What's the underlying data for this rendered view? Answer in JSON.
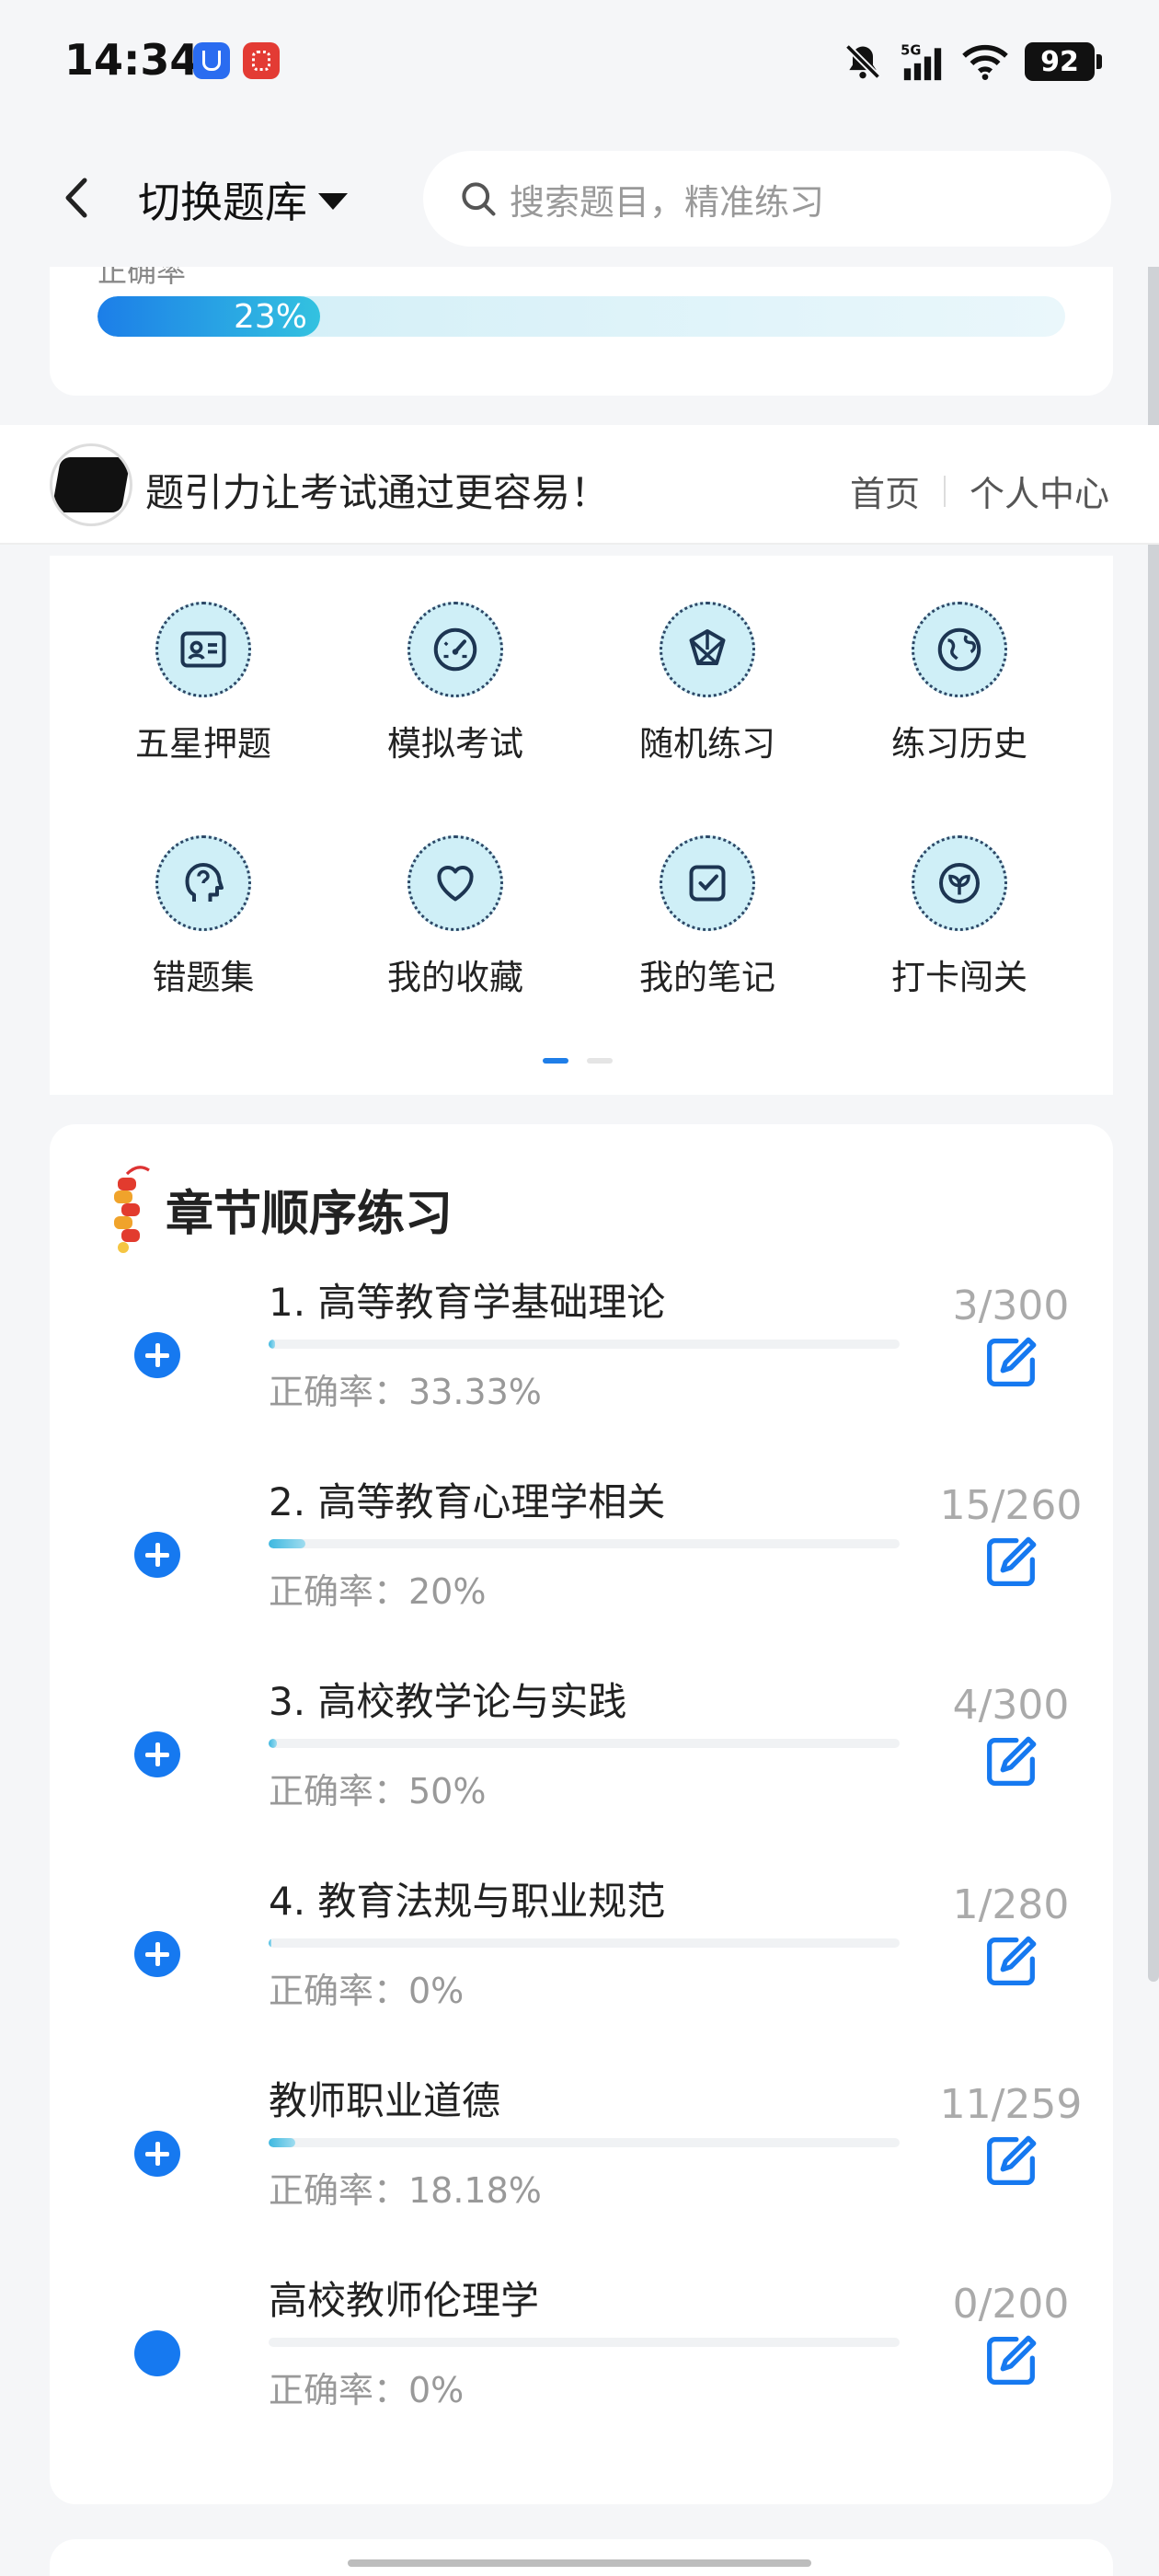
{
  "status_bar": {
    "time": "14:34",
    "battery": "92",
    "icons": [
      "app-u-icon",
      "app-red-icon",
      "bell-muted-icon",
      "signal-5g-icon",
      "wifi-icon",
      "battery-icon"
    ]
  },
  "header": {
    "switch_label": "切换题库",
    "search_placeholder": "搜索题目，精准练习"
  },
  "accuracy_card": {
    "label": "正确率",
    "percent_text": "23%",
    "percent_value": 23
  },
  "brand": {
    "slogan": "题引力让考试通过更容易！",
    "links": [
      "首页",
      "个人中心"
    ]
  },
  "menu": {
    "items": [
      {
        "label": "五星押题",
        "icon": "id-card-icon"
      },
      {
        "label": "模拟考试",
        "icon": "speedometer-icon"
      },
      {
        "label": "随机练习",
        "icon": "shuffle-network-icon"
      },
      {
        "label": "练习历史",
        "icon": "globe-icon"
      },
      {
        "label": "错题集",
        "icon": "head-brain-icon"
      },
      {
        "label": "我的收藏",
        "icon": "heart-icon"
      },
      {
        "label": "我的笔记",
        "icon": "note-check-icon"
      },
      {
        "label": "打卡闯关",
        "icon": "leaf-badge-icon"
      }
    ],
    "page_indicator": {
      "pages": 2,
      "active": 0
    }
  },
  "chapters": {
    "title": "章节顺序练习",
    "items": [
      {
        "name": "1. 高等教育学基础理论",
        "accuracy": "正确率：33.33%",
        "count": "3/300",
        "progress": 0.01,
        "expandable": true
      },
      {
        "name": "2. 高等教育心理学相关",
        "accuracy": "正确率：20%",
        "count": "15/260",
        "progress": 0.058,
        "expandable": true
      },
      {
        "name": "3. 高校教学论与实践",
        "accuracy": "正确率：50%",
        "count": "4/300",
        "progress": 0.013,
        "expandable": true
      },
      {
        "name": "4. 教育法规与职业规范",
        "accuracy": "正确率：0%",
        "count": "1/280",
        "progress": 0.004,
        "expandable": true
      },
      {
        "name": "教师职业道德",
        "accuracy": "正确率：18.18%",
        "count": "11/259",
        "progress": 0.042,
        "expandable": true
      },
      {
        "name": "高校教师伦理学",
        "accuracy": "正确率：0%",
        "count": "0/200",
        "progress": 0,
        "expandable": false
      }
    ]
  }
}
